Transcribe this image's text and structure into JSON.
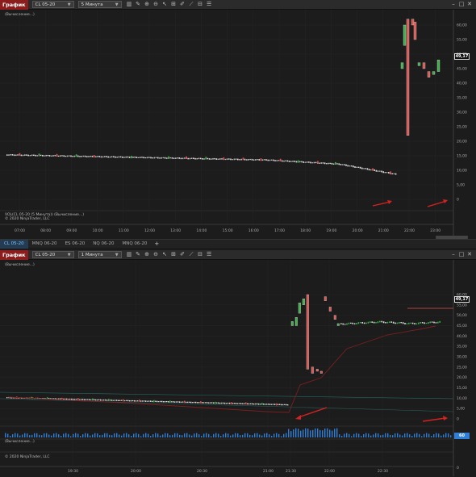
{
  "top_window": {
    "title": "График",
    "instrument": "CL 05-20",
    "period": "5 Минута",
    "calc_status": "(Вычисление...)",
    "vol_label": "VOL(CL 05-20 (5 Минута)) (Вычисление...)",
    "copyright": "© 2020 NinjaTrader, LLC",
    "price_badge": "49,17",
    "y_ticks": [
      "60,00",
      "55,00",
      "50,00",
      "45,00",
      "40,00",
      "35,00",
      "30,00",
      "25,00",
      "20,00",
      "15,00",
      "10,00",
      "5,00",
      "0"
    ],
    "x_ticks": [
      "07:00",
      "08:00",
      "09:00",
      "10:00",
      "11:00",
      "12:00",
      "13:00",
      "14:00",
      "15:00",
      "16:00",
      "17:00",
      "18:00",
      "19:00",
      "20:00",
      "21:00",
      "22:00",
      "23:00"
    ]
  },
  "tabs": [
    {
      "label": "CL 05-20",
      "active": true
    },
    {
      "label": "MNQ 06-20",
      "active": false
    },
    {
      "label": "ES 06-20",
      "active": false
    },
    {
      "label": "NQ 06-20",
      "active": false
    },
    {
      "label": "MNQ 06-20",
      "active": false
    }
  ],
  "tab_add": "+",
  "bottom_window": {
    "title": "График",
    "instrument": "CL 05-20",
    "period": "1 Минута",
    "calc_status": "(Вычисление...)",
    "calc_status_2": "(Вычисление...)",
    "copyright": "© 2020 NinjaTrader, LLC",
    "price_badge": "49,17",
    "vol_badge": "60",
    "y_ticks": [
      "60,00",
      "55,00",
      "50,00",
      "45,00",
      "40,00",
      "35,00",
      "30,00",
      "25,00",
      "20,00",
      "15,00",
      "10,00",
      "5,00",
      "0"
    ],
    "x_ticks": [
      "19:30",
      "20:00",
      "20:30",
      "21:00",
      "21:30",
      "22:00",
      "22:30"
    ],
    "vol_zero": "0"
  },
  "toolbar_icons": [
    "bar-chart-icon",
    "pencil-icon",
    "zoom-in-icon",
    "zoom-out-icon",
    "cursor-icon",
    "template-icon",
    "drawing-icon",
    "strategy-icon",
    "indicator-icon",
    "properties-icon"
  ],
  "colors": {
    "up": "#3fae49",
    "down": "#d9534f",
    "title_bg": "#8b1d1d",
    "arrow": "#d22222",
    "volume": "#2f7fd8"
  }
}
